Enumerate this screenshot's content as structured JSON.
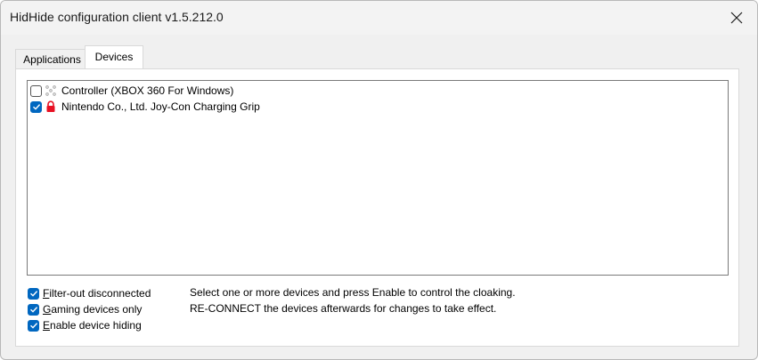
{
  "window": {
    "title": "HidHide configuration client v1.5.212.0"
  },
  "tabs": [
    {
      "label": "Applications",
      "active": false
    },
    {
      "label": "Devices",
      "active": true
    }
  ],
  "devices": [
    {
      "label": "Controller (XBOX 360 For Windows)",
      "checked": false,
      "icon": "gamepad-icon"
    },
    {
      "label": "Nintendo Co., Ltd. Joy-Con Charging Grip",
      "checked": true,
      "icon": "lock-icon"
    }
  ],
  "options": {
    "filter_disconnected": {
      "mnemonic": "F",
      "rest": "ilter-out disconnected",
      "checked": true
    },
    "gaming_only": {
      "mnemonic": "G",
      "rest": "aming devices only",
      "checked": true
    },
    "enable_hiding": {
      "mnemonic": "E",
      "rest": "nable device hiding",
      "checked": true
    }
  },
  "hint": {
    "line1": "Select one or more devices and press Enable to control the cloaking.",
    "line2": "RE-CONNECT the devices afterwards for changes to take effect."
  },
  "colors": {
    "accent": "#0067c0",
    "lock_red": "#e81123"
  }
}
